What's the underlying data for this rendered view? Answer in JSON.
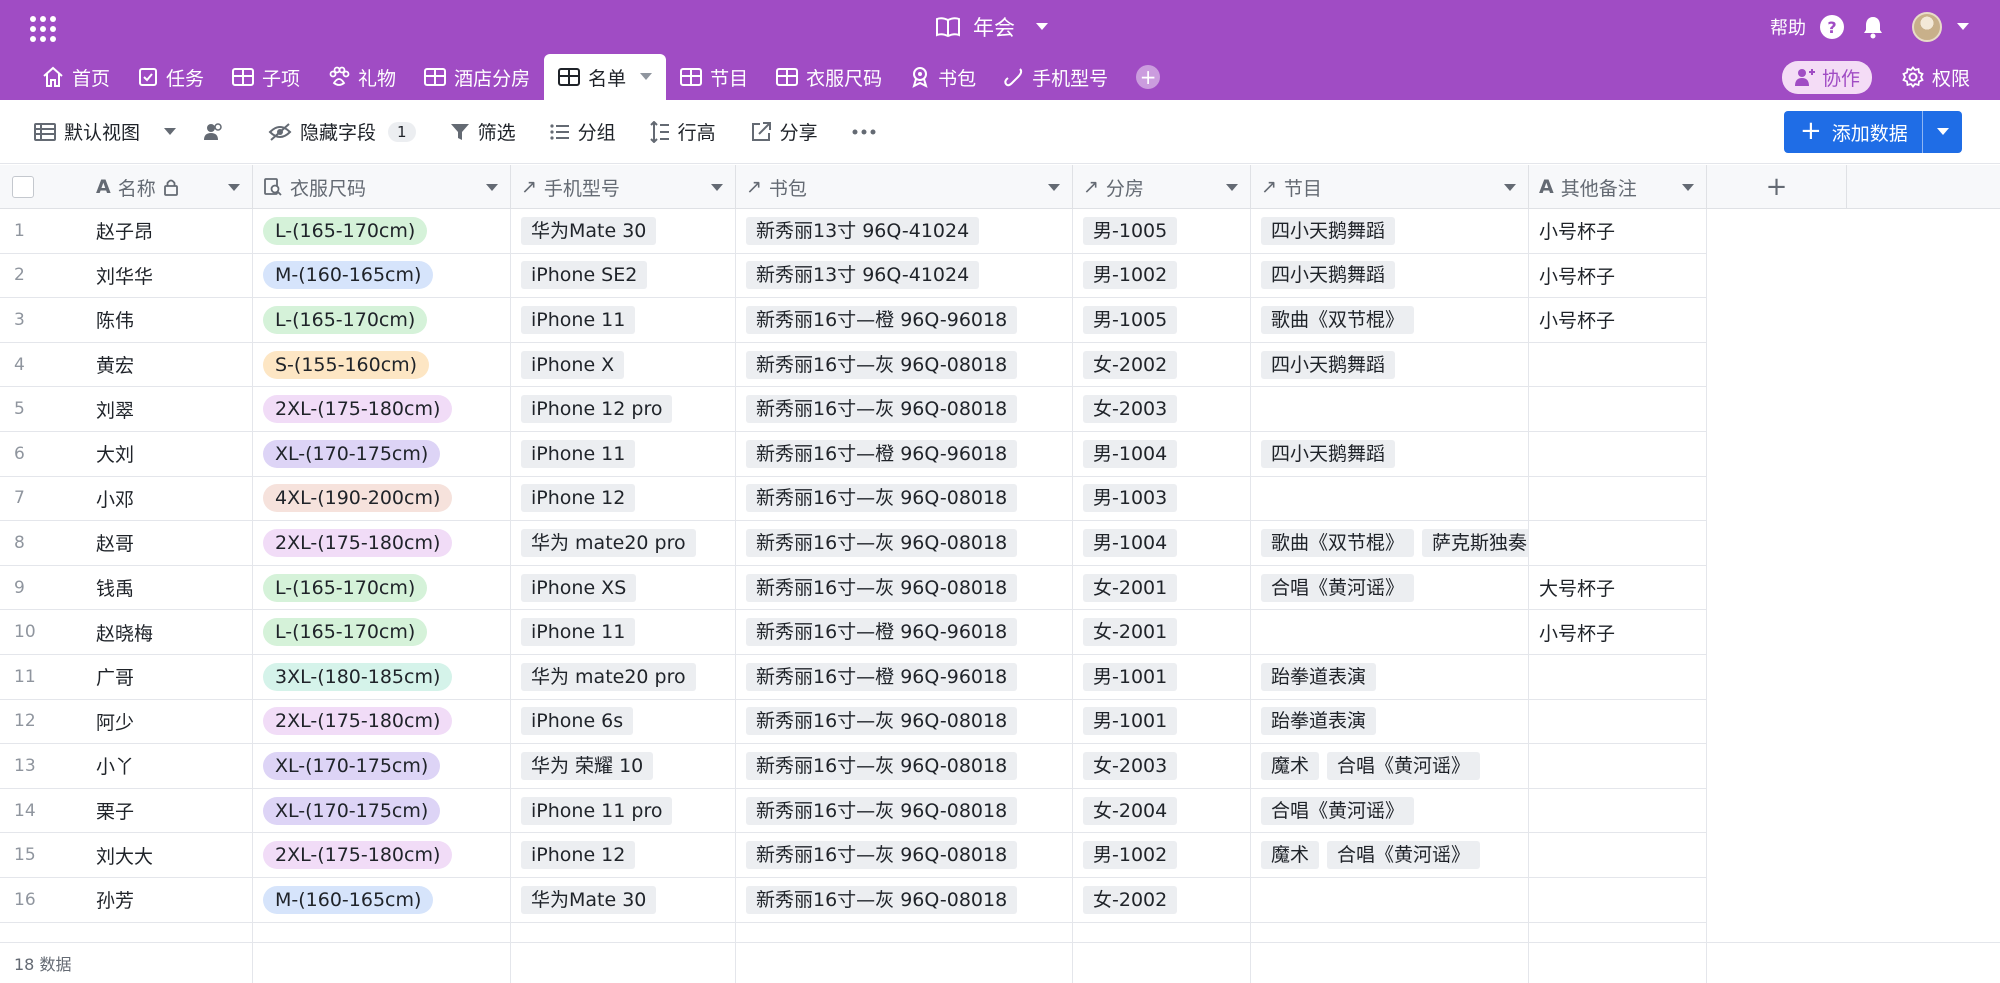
{
  "app": {
    "title": "年会",
    "help_label": "帮助"
  },
  "tabs": [
    {
      "label": "首页",
      "icon": "home-icon"
    },
    {
      "label": "任务",
      "icon": "checkbox-icon"
    },
    {
      "label": "子项",
      "icon": "table-icon"
    },
    {
      "label": "礼物",
      "icon": "paw-icon"
    },
    {
      "label": "酒店分房",
      "icon": "table-icon"
    },
    {
      "label": "名单",
      "icon": "table-icon",
      "active": true
    },
    {
      "label": "节目",
      "icon": "table-icon"
    },
    {
      "label": "衣服尺码",
      "icon": "table-icon"
    },
    {
      "label": "书包",
      "icon": "badge-icon"
    },
    {
      "label": "手机型号",
      "icon": "link-icon"
    }
  ],
  "right_tabs": {
    "collab_label": "协作",
    "permission_label": "权限"
  },
  "toolbar": {
    "view_label": "默认视图",
    "hidden_fields_label": "隐藏字段",
    "hidden_fields_count": "1",
    "filter_label": "筛选",
    "group_label": "分组",
    "row_height_label": "行高",
    "share_label": "分享",
    "add_data_label": "添加数据"
  },
  "columns": [
    {
      "label": "名称",
      "icon": "text-icon"
    },
    {
      "label": "衣服尺码",
      "icon": "lookup-icon"
    },
    {
      "label": "手机型号",
      "icon": "link-arrow-icon"
    },
    {
      "label": "书包",
      "icon": "link-arrow-icon"
    },
    {
      "label": "分房",
      "icon": "link-arrow-icon"
    },
    {
      "label": "节目",
      "icon": "link-arrow-icon"
    },
    {
      "label": "其他备注",
      "icon": "text-icon"
    }
  ],
  "size_colors": {
    "S-(155-160cm)": "#fde6c4",
    "M-(160-165cm)": "#d6e4fb",
    "L-(165-170cm)": "#d5f2d9",
    "XL-(170-175cm)": "#ddd4f6",
    "2XL-(175-180cm)": "#f1dcf7",
    "3XL-(180-185cm)": "#d5f3ea",
    "4XL-(190-200cm)": "#f6e2dc"
  },
  "rows": [
    {
      "num": "1",
      "name": "赵子昂",
      "size": "L-(165-170cm)",
      "phone": "华为Mate 30",
      "bag": "新秀丽13寸 96Q-41024",
      "room": "男-1005",
      "shows": [
        "四小天鹅舞蹈"
      ],
      "note": "小号杯子"
    },
    {
      "num": "2",
      "name": "刘华华",
      "size": "M-(160-165cm)",
      "phone": "iPhone SE2",
      "bag": "新秀丽13寸 96Q-41024",
      "room": "男-1002",
      "shows": [
        "四小天鹅舞蹈"
      ],
      "note": "小号杯子"
    },
    {
      "num": "3",
      "name": "陈伟",
      "size": "L-(165-170cm)",
      "phone": "iPhone 11",
      "bag": "新秀丽16寸—橙 96Q-96018",
      "room": "男-1005",
      "shows": [
        "歌曲《双节棍》"
      ],
      "note": "小号杯子"
    },
    {
      "num": "4",
      "name": "黄宏",
      "size": "S-(155-160cm)",
      "phone": "iPhone X",
      "bag": "新秀丽16寸—灰 96Q-08018",
      "room": "女-2002",
      "shows": [
        "四小天鹅舞蹈"
      ],
      "note": ""
    },
    {
      "num": "5",
      "name": "刘翠",
      "size": "2XL-(175-180cm)",
      "phone": "iPhone 12 pro",
      "bag": "新秀丽16寸—灰 96Q-08018",
      "room": "女-2003",
      "shows": [],
      "note": ""
    },
    {
      "num": "6",
      "name": "大刘",
      "size": "XL-(170-175cm)",
      "phone": "iPhone 11",
      "bag": "新秀丽16寸—橙 96Q-96018",
      "room": "男-1004",
      "shows": [
        "四小天鹅舞蹈"
      ],
      "note": ""
    },
    {
      "num": "7",
      "name": "小邓",
      "size": "4XL-(190-200cm)",
      "phone": "iPhone 12",
      "bag": "新秀丽16寸—灰 96Q-08018",
      "room": "男-1003",
      "shows": [],
      "note": ""
    },
    {
      "num": "8",
      "name": "赵哥",
      "size": "2XL-(175-180cm)",
      "phone": "华为 mate20 pro",
      "bag": "新秀丽16寸—灰 96Q-08018",
      "room": "男-1004",
      "shows": [
        "歌曲《双节棍》",
        "萨克斯独奏"
      ],
      "note": ""
    },
    {
      "num": "9",
      "name": "钱禹",
      "size": "L-(165-170cm)",
      "phone": "iPhone XS",
      "bag": "新秀丽16寸—灰 96Q-08018",
      "room": "女-2001",
      "shows": [
        "合唱《黄河谣》"
      ],
      "note": "大号杯子"
    },
    {
      "num": "10",
      "name": "赵晓梅",
      "size": "L-(165-170cm)",
      "phone": "iPhone 11",
      "bag": "新秀丽16寸—橙 96Q-96018",
      "room": "女-2001",
      "shows": [],
      "note": "小号杯子"
    },
    {
      "num": "11",
      "name": "广哥",
      "size": "3XL-(180-185cm)",
      "phone": "华为 mate20 pro",
      "bag": "新秀丽16寸—橙 96Q-96018",
      "room": "男-1001",
      "shows": [
        "跆拳道表演"
      ],
      "note": ""
    },
    {
      "num": "12",
      "name": "阿少",
      "size": "2XL-(175-180cm)",
      "phone": "iPhone 6s",
      "bag": "新秀丽16寸—灰 96Q-08018",
      "room": "男-1001",
      "shows": [
        "跆拳道表演"
      ],
      "note": ""
    },
    {
      "num": "13",
      "name": "小丫",
      "size": "XL-(170-175cm)",
      "phone": "华为 荣耀 10",
      "bag": "新秀丽16寸—灰 96Q-08018",
      "room": "女-2003",
      "shows": [
        "魔术",
        "合唱《黄河谣》"
      ],
      "note": ""
    },
    {
      "num": "14",
      "name": "栗子",
      "size": "XL-(170-175cm)",
      "phone": "iPhone 11 pro",
      "bag": "新秀丽16寸—灰 96Q-08018",
      "room": "女-2004",
      "shows": [
        "合唱《黄河谣》"
      ],
      "note": ""
    },
    {
      "num": "15",
      "name": "刘大大",
      "size": "2XL-(175-180cm)",
      "phone": "iPhone 12",
      "bag": "新秀丽16寸—灰 96Q-08018",
      "room": "男-1002",
      "shows": [
        "魔术",
        "合唱《黄河谣》"
      ],
      "note": ""
    },
    {
      "num": "16",
      "name": "孙芳",
      "size": "M-(160-165cm)",
      "phone": "华为Mate 30",
      "bag": "新秀丽16寸—灰 96Q-08018",
      "room": "女-2002",
      "shows": [],
      "note": ""
    }
  ],
  "footer": {
    "count_label": "18 数据"
  }
}
